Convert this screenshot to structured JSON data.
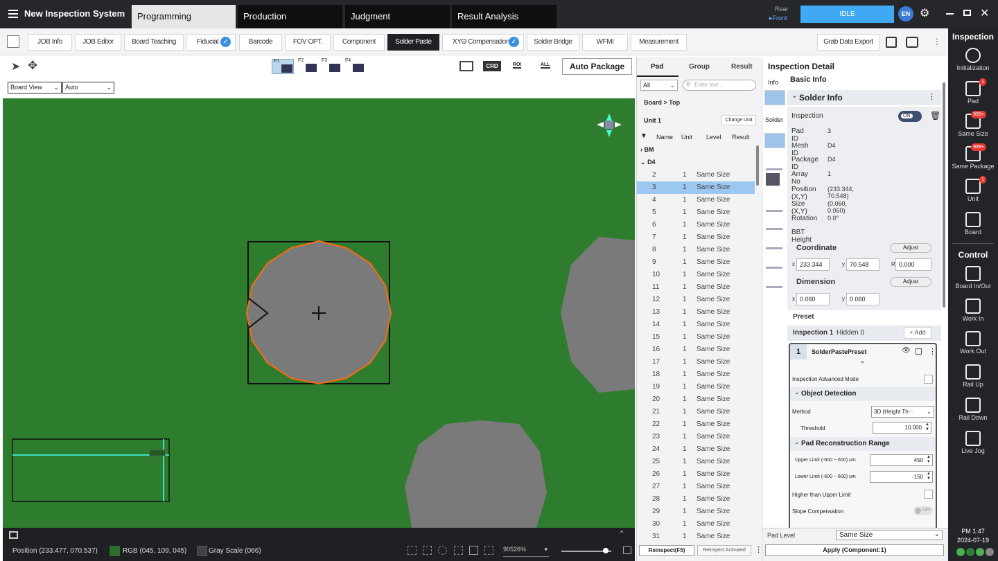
{
  "app": {
    "title": "New Inspection System",
    "lang": "EN",
    "status": "IDLE",
    "rear": "Rear",
    "front": "▸Front"
  },
  "main_tabs": [
    "Programming",
    "Production",
    "Judgment",
    "Result Analysis"
  ],
  "sub_tabs": [
    "JOB Info",
    "JOB Editor",
    "Board Teaching",
    "Fiducial",
    "Barcode",
    "FOV OPT.",
    "Component",
    "Solder Paste",
    "XYΘ Compensation",
    "Solder Bridge",
    "WFMI",
    "Measurement"
  ],
  "grab_export": "Grab Data Export",
  "toolbar": {
    "f_keys": [
      "F1",
      "F2",
      "F3",
      "F4"
    ],
    "crd": "CRD",
    "roi": "ROI",
    "all": "ALL",
    "auto_package": "Auto Package",
    "board_view": "Board View",
    "auto": "Auto"
  },
  "status": {
    "position": "Position (233.477, 070.537)",
    "rgb": "RGB (045, 109, 045)",
    "gray": "Gray Scale (066)",
    "zoom": "90526%",
    "rgb_color": "#2d6d2d",
    "gray_color": "#424242"
  },
  "mid": {
    "tabs": [
      "Pad",
      "Group",
      "Result"
    ],
    "filter": "All",
    "search_placeholder": "Enter text...",
    "breadcrumb": "Board > Top",
    "unit": "Unit 1",
    "change_unit": "Change Unit",
    "cols": [
      "Name",
      "Unit",
      "Level",
      "Result"
    ],
    "groups": [
      "BM",
      "D4"
    ],
    "rows": [
      [
        "2",
        "1",
        "Same Size"
      ],
      [
        "3",
        "1",
        "Same Size"
      ],
      [
        "4",
        "1",
        "Same Size"
      ],
      [
        "5",
        "1",
        "Same Size"
      ],
      [
        "6",
        "1",
        "Same Size"
      ],
      [
        "7",
        "1",
        "Same Size"
      ],
      [
        "8",
        "1",
        "Same Size"
      ],
      [
        "9",
        "1",
        "Same Size"
      ],
      [
        "10",
        "1",
        "Same Size"
      ],
      [
        "11",
        "1",
        "Same Size"
      ],
      [
        "12",
        "1",
        "Same Size"
      ],
      [
        "13",
        "1",
        "Same Size"
      ],
      [
        "14",
        "1",
        "Same Size"
      ],
      [
        "15",
        "1",
        "Same Size"
      ],
      [
        "16",
        "1",
        "Same Size"
      ],
      [
        "17",
        "1",
        "Same Size"
      ],
      [
        "18",
        "1",
        "Same Size"
      ],
      [
        "19",
        "1",
        "Same Size"
      ],
      [
        "20",
        "1",
        "Same Size"
      ],
      [
        "21",
        "1",
        "Same Size"
      ],
      [
        "22",
        "1",
        "Same Size"
      ],
      [
        "23",
        "1",
        "Same Size"
      ],
      [
        "24",
        "1",
        "Same Size"
      ],
      [
        "25",
        "1",
        "Same Size"
      ],
      [
        "26",
        "1",
        "Same Size"
      ],
      [
        "27",
        "1",
        "Same Size"
      ],
      [
        "28",
        "1",
        "Same Size"
      ],
      [
        "29",
        "1",
        "Same Size"
      ],
      [
        "30",
        "1",
        "Same Size"
      ],
      [
        "31",
        "1",
        "Same Size"
      ]
    ],
    "reinspect": "Reinspect(F5)",
    "reinspect_activated": "Reinspect Activated"
  },
  "detail": {
    "title": "Inspection Detail",
    "side_tabs": [
      "Info",
      "Solder"
    ],
    "basic_info": "Basic Info",
    "solder_info": "Solder Info",
    "inspection": "Inspection",
    "on": "ON",
    "fields": [
      [
        "Pad ID",
        "3"
      ],
      [
        "Mesh ID",
        "D4"
      ],
      [
        "Package ID",
        "D4"
      ],
      [
        "Array No",
        "1"
      ],
      [
        "Position (X,Y)",
        "(233.344, 70.548)"
      ],
      [
        "Size (X,Y)",
        "(0.060, 0.060)"
      ],
      [
        "Rotation",
        "0.0°"
      ],
      [
        "BBT Height",
        ""
      ]
    ],
    "coordinate": "Coordinate",
    "adjust": "Adjust",
    "cx": "233.344",
    "cy": "70.548",
    "cr": "0.000",
    "dimension": "Dimension",
    "dx": "0.060",
    "dy": "0.060",
    "preset": "Preset",
    "inspection1": "Inspection 1",
    "hidden": "Hidden 0",
    "add": "+ Add",
    "preset_no": "1",
    "preset_name": "SolderPastePreset",
    "adv_mode": "Inspection Advanced Mode",
    "object_detection": "Object Detection",
    "method": "Method",
    "method_val": "3D (Height Th···",
    "threshold": "Threshold",
    "threshold_val": "10.000",
    "pad_recon": "Pad Reconstruction Range",
    "upper": "Upper Limit (-600 ~ 600) um",
    "upper_val": "450",
    "lower": "Lower Limit (-600 ~ 600) um",
    "lower_val": "-150",
    "higher": "Higher than Upper Limit",
    "slope": "Slope Compensation",
    "off": "OFF",
    "pad_level": "Pad Level",
    "pad_level_val": "Same Size",
    "apply": "Apply (Component:1)"
  },
  "right": {
    "inspection_title": "Inspection",
    "control_title": "Control",
    "items": [
      {
        "label": "Initialization",
        "badge": ""
      },
      {
        "label": "Pad",
        "badge": "1"
      },
      {
        "label": "Same Size",
        "badge": "999+"
      },
      {
        "label": "Same Package",
        "badge": "999+"
      },
      {
        "label": "Unit",
        "badge": "1"
      },
      {
        "label": "Board",
        "badge": ""
      }
    ],
    "controls": [
      "Board In/Out",
      "Work In",
      "Work Out",
      "Rail Up",
      "Rail Down",
      "Live Jog"
    ],
    "time": "PM 1:47",
    "date": "2024-07-19"
  }
}
